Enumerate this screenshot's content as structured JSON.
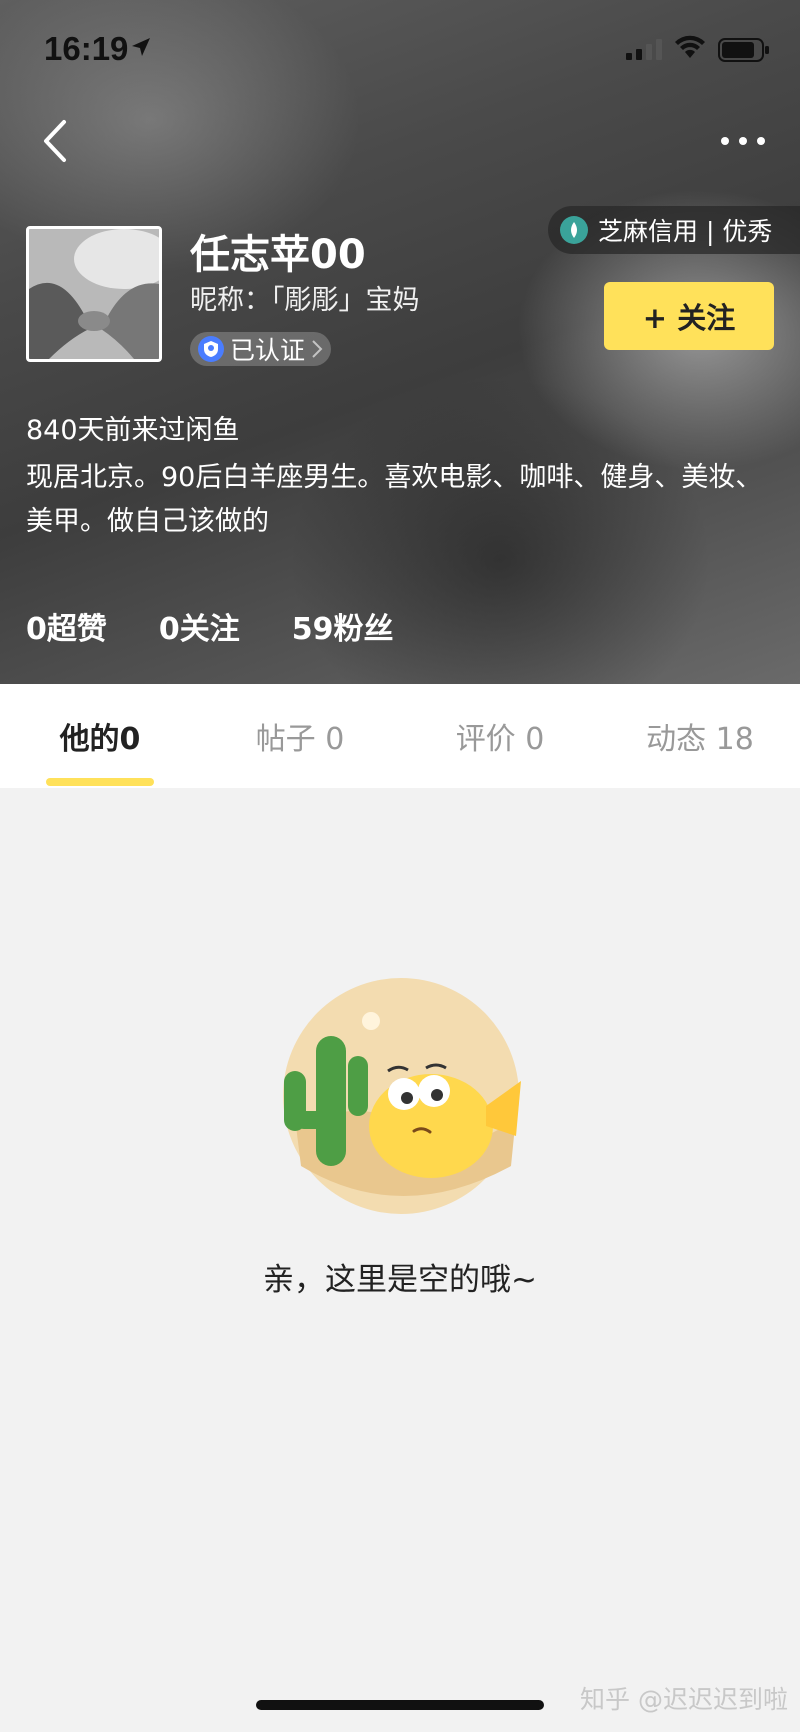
{
  "status_bar": {
    "time": "16:19"
  },
  "profile": {
    "username": "任志苹00",
    "nickname": "昵称：「彫彫」宝妈",
    "verified_label": "已认证",
    "credit_badge": "芝麻信用 | 优秀",
    "follow_button": "+ 关注",
    "last_visit": "840天前来过闲鱼",
    "bio": "现居北京。90后白羊座男生。喜欢电影、咖啡、健身、美妆、美甲。做自己该做的"
  },
  "stats": {
    "likes": "0超赞",
    "following": "0关注",
    "fans": "59粉丝"
  },
  "tabs": [
    {
      "label": "他的0",
      "active": true
    },
    {
      "label": "帖子 0",
      "active": false
    },
    {
      "label": "评价 0",
      "active": false
    },
    {
      "label": "动态 18",
      "active": false
    }
  ],
  "empty_state": {
    "message": "亲，这里是空的哦~"
  },
  "watermark": "知乎 @迟迟迟到啦",
  "colors": {
    "accent": "#ffe15a",
    "verified_blue": "#4a7dff",
    "credit_teal": "#3aa39a"
  }
}
